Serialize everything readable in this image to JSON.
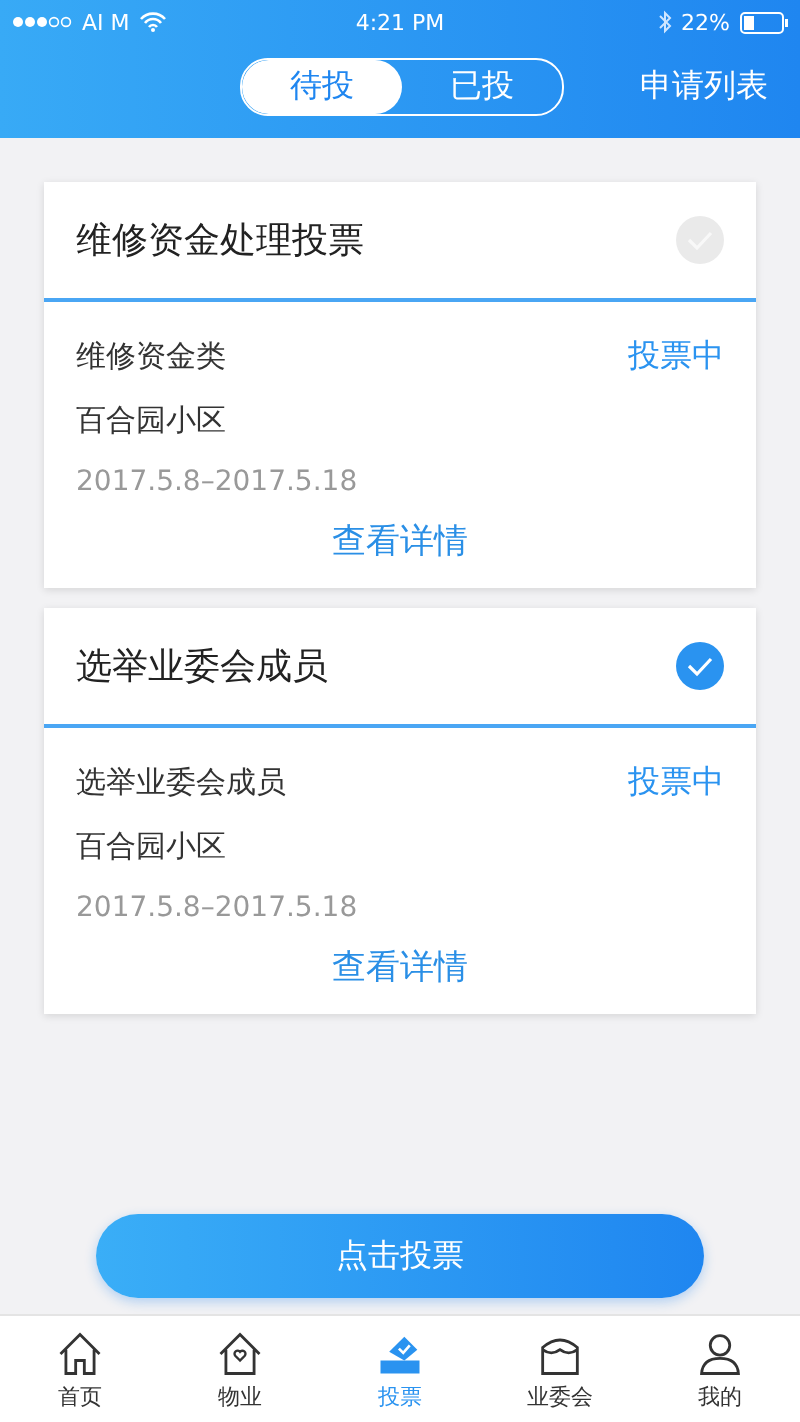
{
  "status_bar": {
    "carrier": "AI M",
    "time": "4:21 PM",
    "battery": "22%"
  },
  "header": {
    "tabs": [
      {
        "label": "待投",
        "selected": true
      },
      {
        "label": "已投",
        "selected": false
      }
    ],
    "action": "申请列表"
  },
  "votes": [
    {
      "title": "维修资金处理投票",
      "checked": false,
      "category": "维修资金类",
      "status": "投票中",
      "community": "百合园小区",
      "dates": "2017.5.8–2017.5.18",
      "link": "查看详情"
    },
    {
      "title": "选举业委会成员",
      "checked": true,
      "category": "选举业委会成员",
      "status": "投票中",
      "community": "百合园小区",
      "dates": "2017.5.8–2017.5.18",
      "link": "查看详情"
    }
  ],
  "vote_button": "点击投票",
  "nav": [
    {
      "label": "首页",
      "kind": "home",
      "selected": false
    },
    {
      "label": "物业",
      "kind": "property",
      "selected": false
    },
    {
      "label": "投票",
      "kind": "vote",
      "selected": true
    },
    {
      "label": "业委会",
      "kind": "committee",
      "selected": false
    },
    {
      "label": "我的",
      "kind": "me",
      "selected": false
    }
  ]
}
